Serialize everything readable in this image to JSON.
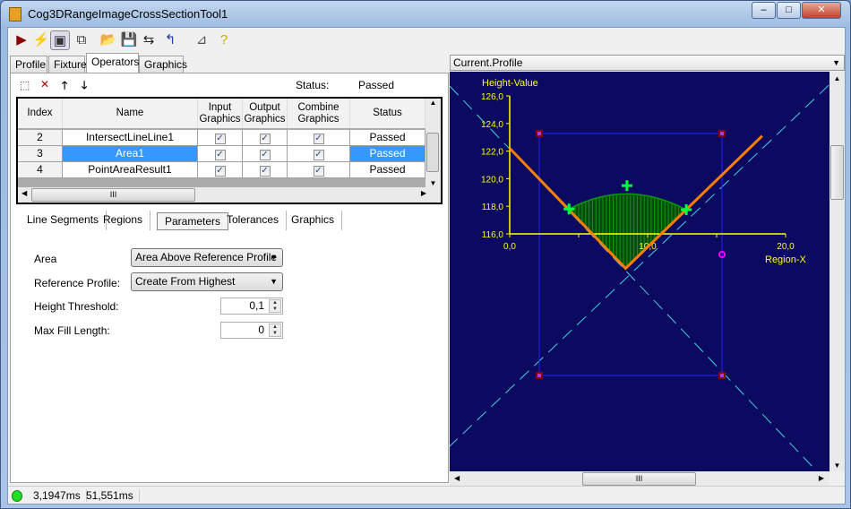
{
  "window": {
    "title": "Cog3DRangeImageCrossSectionTool1",
    "minimize": "‒",
    "maximize": "□",
    "close": "✕"
  },
  "toolbar": [
    {
      "name": "run-icon",
      "glyph": "▶",
      "color": "#8b0000"
    },
    {
      "name": "lightning-icon",
      "glyph": "⚡",
      "color": "#d4c000"
    },
    {
      "name": "show-graphics-icon",
      "glyph": "▣",
      "color": "#333"
    },
    {
      "name": "floating-graphics-icon",
      "glyph": "⧉",
      "color": "#333"
    },
    {
      "name": "open-icon",
      "glyph": "📂",
      "color": "#b08800"
    },
    {
      "name": "save-icon",
      "glyph": "💾",
      "color": "#222"
    },
    {
      "name": "save-as-icon",
      "glyph": "⇆",
      "color": "#222"
    },
    {
      "name": "reset-icon",
      "glyph": "↰",
      "color": "#1a3fa0"
    },
    {
      "name": "train-icon",
      "glyph": "⊿",
      "color": "#555"
    },
    {
      "name": "help-icon",
      "glyph": "?",
      "color": "#c9a800"
    }
  ],
  "main_tabs": [
    "Profile",
    "Fixture",
    "Operators",
    "Graphics"
  ],
  "active_main_tab": "Operators",
  "operators": {
    "status_label": "Status:",
    "status_value": "Passed",
    "columns": [
      "Index",
      "Name",
      "Input Graphics",
      "Output Graphics",
      "Combine Graphics",
      "Status"
    ],
    "rows": [
      {
        "index": "2",
        "name": "IntersectLineLine1",
        "input": true,
        "output": true,
        "combine": true,
        "status": "Passed"
      },
      {
        "index": "3",
        "name": "Area1",
        "input": true,
        "output": true,
        "combine": true,
        "status": "Passed",
        "selected": true
      },
      {
        "index": "4",
        "name": "PointAreaResult1",
        "input": true,
        "output": true,
        "combine": true,
        "status": "Passed"
      }
    ],
    "hscroll_grip": "III"
  },
  "sub_tabs": [
    "Line Segments",
    "Regions",
    "Parameters",
    "Tolerances",
    "Graphics"
  ],
  "active_sub_tab": "Parameters",
  "parameters": {
    "area_label": "Area",
    "area_value": "Area Above Reference Profile",
    "ref_label": "Reference Profile:",
    "ref_value": "Create From Highest",
    "threshold_label": "Height Threshold:",
    "threshold_value": "0,1",
    "maxfill_label": "Max Fill Length:",
    "maxfill_value": "0"
  },
  "display": {
    "selector": "Current.Profile",
    "y_axis_label": "Height-Value",
    "x_axis_label": "Region-X",
    "y_ticks": [
      "116,0",
      "118,0",
      "120,0",
      "122,0",
      "124,0",
      "126,0"
    ],
    "x_ticks": [
      "0,0",
      "10,0",
      "20,0"
    ],
    "colors": {
      "background": "#0b0a60",
      "axis": "#ffff00",
      "profile": "#ff8000",
      "fill": "#0a9a0a",
      "marker": "#00ff40",
      "guide": "#40d0e0",
      "region": "#2020ff"
    },
    "profile": [
      [
        0,
        122.2
      ],
      [
        8.4,
        113.5
      ],
      [
        18.3,
        123.1
      ]
    ],
    "area_points": [
      [
        4.3,
        117.8
      ],
      [
        8.5,
        119.5
      ],
      [
        12.8,
        117.75
      ]
    ]
  },
  "statusbar": {
    "time1": "3,1947ms",
    "time2": "51,551ms",
    "indicator_color": "#22dd22"
  }
}
